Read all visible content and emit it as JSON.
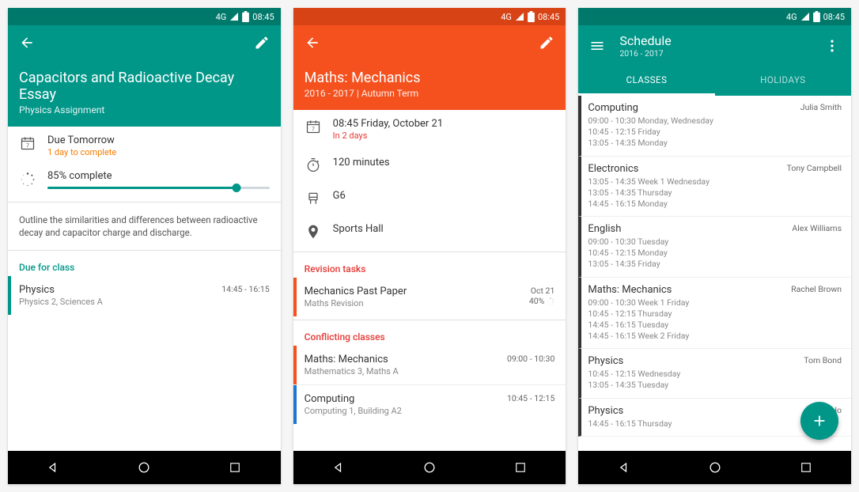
{
  "status": {
    "time": "08:45",
    "net": "4G"
  },
  "screen1": {
    "hero": {
      "title": "Capacitors and Radioactive Decay Essay",
      "subtitle": "Physics Assignment"
    },
    "due": {
      "title": "Due Tomorrow",
      "warn": "1 day to complete"
    },
    "progress": {
      "label": "85% complete",
      "percent": 85
    },
    "description": "Outline the similarities and differences between radioactive decay and capacitor charge and discharge.",
    "section": "Due for class",
    "class": {
      "title": "Physics",
      "sub": "Physics 2, Sciences A",
      "time": "14:45 - 16:15"
    }
  },
  "screen2": {
    "hero": {
      "title": "Maths: Mechanics",
      "subtitle": "2016 - 2017 | Autumn Term"
    },
    "details": {
      "datetime": "08:45 Friday, October 21",
      "countdown": "In 2 days",
      "duration": "120 minutes",
      "room": "G6",
      "location": "Sports Hall"
    },
    "sections": {
      "revision": "Revision tasks",
      "conflicts": "Conflicting classes"
    },
    "revision": {
      "title": "Mechanics Past Paper",
      "sub": "Maths Revision",
      "date": "Oct 21",
      "pct": "40%"
    },
    "conflicts": [
      {
        "title": "Maths: Mechanics",
        "sub": "Mathematics 3, Maths A",
        "time": "09:00 - 10:30"
      },
      {
        "title": "Computing",
        "sub": "Computing 1, Building A2",
        "time": "10:45 - 12:15"
      }
    ]
  },
  "screen3": {
    "title": "Schedule",
    "subtitle": "2016 - 2017",
    "tabs": {
      "classes": "CLASSES",
      "holidays": "HOLIDAYS"
    },
    "items": [
      {
        "title": "Computing",
        "teacher": "Julia Smith",
        "lines": [
          "09:00 - 10:30 Monday, Wednesday",
          "10:45 - 12:15 Friday",
          "13:05 - 14:35 Monday"
        ],
        "color": "blue"
      },
      {
        "title": "Electronics",
        "teacher": "Tony Campbell",
        "lines": [
          "13:05 - 14:35 Week 1 Wednesday",
          "13:05 - 14:35 Thursday",
          "14:45 - 16:15 Monday"
        ],
        "color": "cream"
      },
      {
        "title": "English",
        "teacher": "Alex Williams",
        "lines": [
          "09:00 - 10:30 Tuesday",
          "10:45 - 12:15 Monday",
          "13:05 - 14:35 Friday"
        ],
        "color": "amber"
      },
      {
        "title": "Maths: Mechanics",
        "teacher": "Rachel Brown",
        "lines": [
          "09:00 - 10:30 Week 1 Friday",
          "10:45 - 12:15 Thursday",
          "14:45 - 16:15 Tuesday",
          "14:45 - 16:15 Week 2 Friday"
        ],
        "color": "red"
      },
      {
        "title": "Physics",
        "teacher": "Tom Bond",
        "lines": [
          "10:45 - 12:15 Wednesday",
          "13:05 - 14:35 Tuesday"
        ],
        "color": "green"
      },
      {
        "title": "Physics",
        "teacher": "Jo",
        "lines": [
          "14:45 - 16:15 Thursday"
        ],
        "color": "teal"
      }
    ]
  }
}
